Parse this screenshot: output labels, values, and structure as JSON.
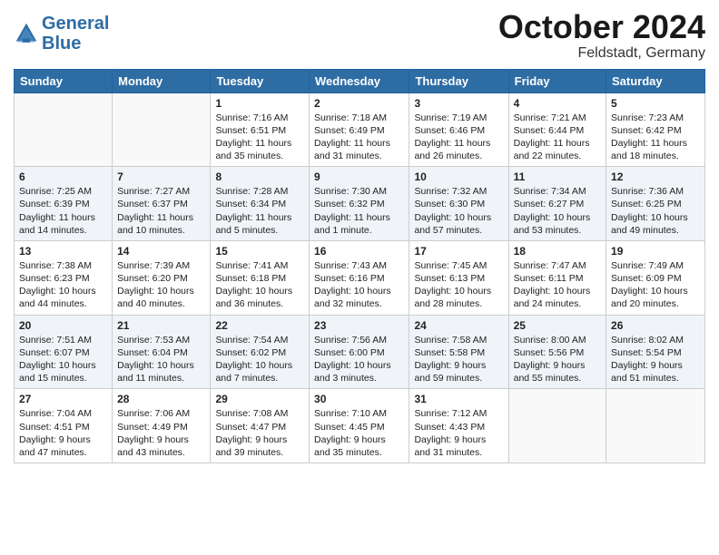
{
  "logo": {
    "line1": "General",
    "line2": "Blue"
  },
  "title": "October 2024",
  "location": "Feldstadt, Germany",
  "headers": [
    "Sunday",
    "Monday",
    "Tuesday",
    "Wednesday",
    "Thursday",
    "Friday",
    "Saturday"
  ],
  "weeks": [
    [
      {
        "day": "",
        "content": ""
      },
      {
        "day": "",
        "content": ""
      },
      {
        "day": "1",
        "content": "Sunrise: 7:16 AM\nSunset: 6:51 PM\nDaylight: 11 hours\nand 35 minutes."
      },
      {
        "day": "2",
        "content": "Sunrise: 7:18 AM\nSunset: 6:49 PM\nDaylight: 11 hours\nand 31 minutes."
      },
      {
        "day": "3",
        "content": "Sunrise: 7:19 AM\nSunset: 6:46 PM\nDaylight: 11 hours\nand 26 minutes."
      },
      {
        "day": "4",
        "content": "Sunrise: 7:21 AM\nSunset: 6:44 PM\nDaylight: 11 hours\nand 22 minutes."
      },
      {
        "day": "5",
        "content": "Sunrise: 7:23 AM\nSunset: 6:42 PM\nDaylight: 11 hours\nand 18 minutes."
      }
    ],
    [
      {
        "day": "6",
        "content": "Sunrise: 7:25 AM\nSunset: 6:39 PM\nDaylight: 11 hours\nand 14 minutes."
      },
      {
        "day": "7",
        "content": "Sunrise: 7:27 AM\nSunset: 6:37 PM\nDaylight: 11 hours\nand 10 minutes."
      },
      {
        "day": "8",
        "content": "Sunrise: 7:28 AM\nSunset: 6:34 PM\nDaylight: 11 hours\nand 5 minutes."
      },
      {
        "day": "9",
        "content": "Sunrise: 7:30 AM\nSunset: 6:32 PM\nDaylight: 11 hours\nand 1 minute."
      },
      {
        "day": "10",
        "content": "Sunrise: 7:32 AM\nSunset: 6:30 PM\nDaylight: 10 hours\nand 57 minutes."
      },
      {
        "day": "11",
        "content": "Sunrise: 7:34 AM\nSunset: 6:27 PM\nDaylight: 10 hours\nand 53 minutes."
      },
      {
        "day": "12",
        "content": "Sunrise: 7:36 AM\nSunset: 6:25 PM\nDaylight: 10 hours\nand 49 minutes."
      }
    ],
    [
      {
        "day": "13",
        "content": "Sunrise: 7:38 AM\nSunset: 6:23 PM\nDaylight: 10 hours\nand 44 minutes."
      },
      {
        "day": "14",
        "content": "Sunrise: 7:39 AM\nSunset: 6:20 PM\nDaylight: 10 hours\nand 40 minutes."
      },
      {
        "day": "15",
        "content": "Sunrise: 7:41 AM\nSunset: 6:18 PM\nDaylight: 10 hours\nand 36 minutes."
      },
      {
        "day": "16",
        "content": "Sunrise: 7:43 AM\nSunset: 6:16 PM\nDaylight: 10 hours\nand 32 minutes."
      },
      {
        "day": "17",
        "content": "Sunrise: 7:45 AM\nSunset: 6:13 PM\nDaylight: 10 hours\nand 28 minutes."
      },
      {
        "day": "18",
        "content": "Sunrise: 7:47 AM\nSunset: 6:11 PM\nDaylight: 10 hours\nand 24 minutes."
      },
      {
        "day": "19",
        "content": "Sunrise: 7:49 AM\nSunset: 6:09 PM\nDaylight: 10 hours\nand 20 minutes."
      }
    ],
    [
      {
        "day": "20",
        "content": "Sunrise: 7:51 AM\nSunset: 6:07 PM\nDaylight: 10 hours\nand 15 minutes."
      },
      {
        "day": "21",
        "content": "Sunrise: 7:53 AM\nSunset: 6:04 PM\nDaylight: 10 hours\nand 11 minutes."
      },
      {
        "day": "22",
        "content": "Sunrise: 7:54 AM\nSunset: 6:02 PM\nDaylight: 10 hours\nand 7 minutes."
      },
      {
        "day": "23",
        "content": "Sunrise: 7:56 AM\nSunset: 6:00 PM\nDaylight: 10 hours\nand 3 minutes."
      },
      {
        "day": "24",
        "content": "Sunrise: 7:58 AM\nSunset: 5:58 PM\nDaylight: 9 hours\nand 59 minutes."
      },
      {
        "day": "25",
        "content": "Sunrise: 8:00 AM\nSunset: 5:56 PM\nDaylight: 9 hours\nand 55 minutes."
      },
      {
        "day": "26",
        "content": "Sunrise: 8:02 AM\nSunset: 5:54 PM\nDaylight: 9 hours\nand 51 minutes."
      }
    ],
    [
      {
        "day": "27",
        "content": "Sunrise: 7:04 AM\nSunset: 4:51 PM\nDaylight: 9 hours\nand 47 minutes."
      },
      {
        "day": "28",
        "content": "Sunrise: 7:06 AM\nSunset: 4:49 PM\nDaylight: 9 hours\nand 43 minutes."
      },
      {
        "day": "29",
        "content": "Sunrise: 7:08 AM\nSunset: 4:47 PM\nDaylight: 9 hours\nand 39 minutes."
      },
      {
        "day": "30",
        "content": "Sunrise: 7:10 AM\nSunset: 4:45 PM\nDaylight: 9 hours\nand 35 minutes."
      },
      {
        "day": "31",
        "content": "Sunrise: 7:12 AM\nSunset: 4:43 PM\nDaylight: 9 hours\nand 31 minutes."
      },
      {
        "day": "",
        "content": ""
      },
      {
        "day": "",
        "content": ""
      }
    ]
  ]
}
